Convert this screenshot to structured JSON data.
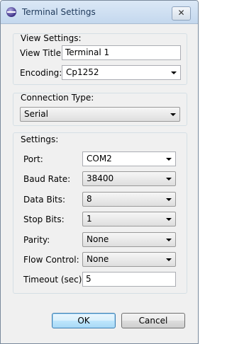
{
  "window": {
    "title": "Terminal Settings",
    "close_label": "✕"
  },
  "view_settings": {
    "group_label": "View Settings:",
    "view_title_label": "View Title:",
    "view_title_value": "Terminal 1",
    "encoding_label": "Encoding:",
    "encoding_value": "Cp1252"
  },
  "connection": {
    "group_label": "Connection Type:",
    "type_value": "Serial"
  },
  "settings": {
    "group_label": "Settings:",
    "port_label": "Port:",
    "port_value": "COM2",
    "baud_label": "Baud Rate:",
    "baud_value": "38400",
    "data_bits_label": "Data Bits:",
    "data_bits_value": "8",
    "stop_bits_label": "Stop Bits:",
    "stop_bits_value": "1",
    "parity_label": "Parity:",
    "parity_value": "None",
    "flow_label": "Flow Control:",
    "flow_value": "None",
    "timeout_label": "Timeout (sec):",
    "timeout_value": "5"
  },
  "buttons": {
    "ok_label": "OK",
    "cancel_label": "Cancel"
  }
}
